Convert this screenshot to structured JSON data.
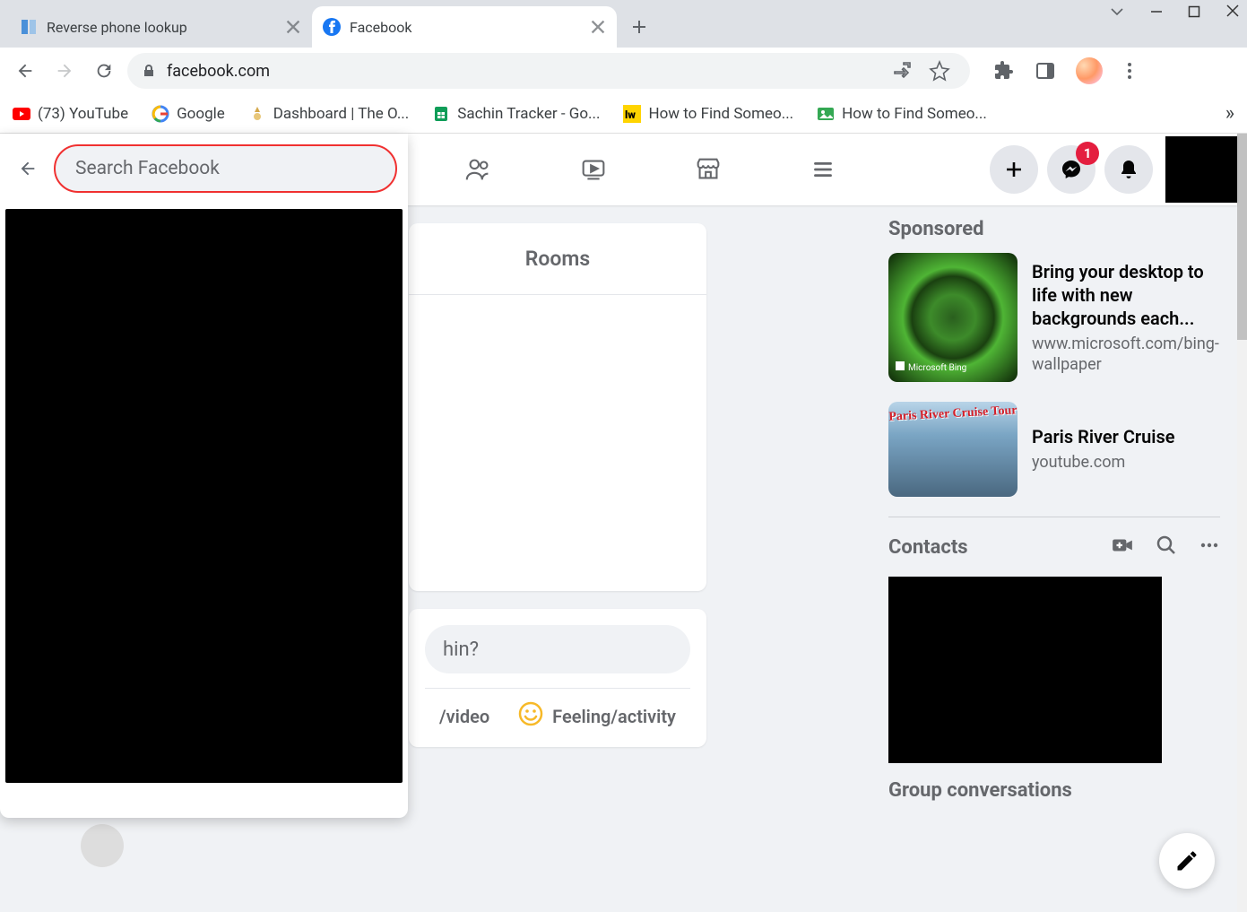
{
  "browser": {
    "tabs": [
      {
        "title": "Reverse phone lookup",
        "active": false
      },
      {
        "title": "Facebook",
        "active": true
      }
    ],
    "url": "facebook.com",
    "bookmarks": [
      {
        "label": "(73) YouTube",
        "icon": "youtube"
      },
      {
        "label": "Google",
        "icon": "google"
      },
      {
        "label": "Dashboard | The O...",
        "icon": "generic"
      },
      {
        "label": "Sachin Tracker - Go...",
        "icon": "sheets"
      },
      {
        "label": "How to Find Someo...",
        "icon": "lw"
      },
      {
        "label": "How to Find Someo...",
        "icon": "pic"
      }
    ]
  },
  "fb": {
    "search_placeholder": "Search Facebook",
    "messenger_badge": "1",
    "rooms_label": "Rooms",
    "compose_prompt": "hin?",
    "compose_video": "/video",
    "compose_feeling": "Feeling/activity",
    "sponsored_label": "Sponsored",
    "ads": [
      {
        "title": "Bring your desktop to life with new backgrounds each...",
        "url": "www.microsoft.com/bing-wallpaper",
        "brand": "Microsoft Bing"
      },
      {
        "title": "Paris River Cruise",
        "url": "youtube.com",
        "overlay": "Paris River Cruise Tour"
      }
    ],
    "contacts_label": "Contacts",
    "group_conv_label": "Group conversations"
  }
}
